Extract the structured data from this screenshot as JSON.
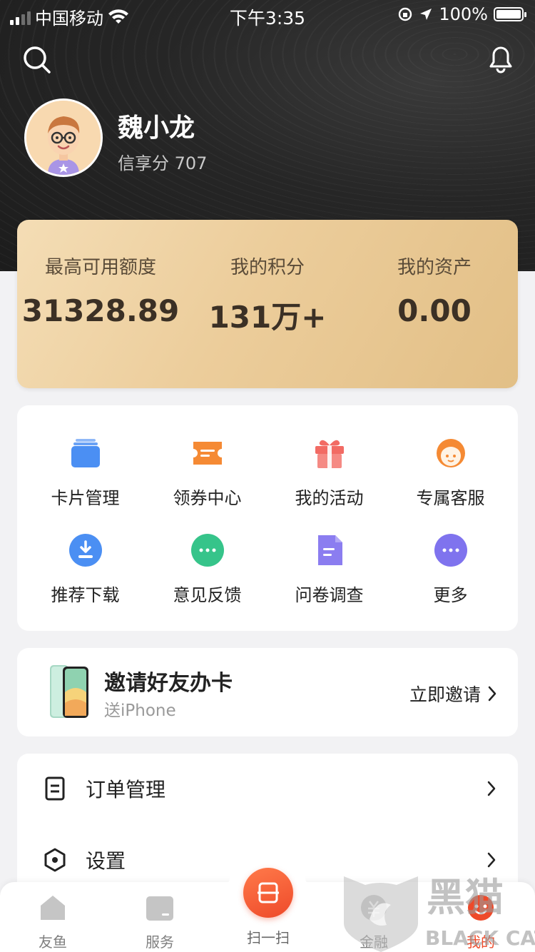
{
  "status_bar": {
    "carrier": "中国移动",
    "time": "下午3:35",
    "battery": "100%"
  },
  "profile": {
    "name": "魏小龙",
    "credit_score_text": "信享分 707"
  },
  "gold_card": [
    {
      "label": "最高可用额度",
      "value": "31328.89"
    },
    {
      "label": "我的积分",
      "value": "131万+"
    },
    {
      "label": "我的资产",
      "value": "0.00"
    }
  ],
  "services": [
    {
      "label": "卡片管理",
      "icon": "card-stack-icon",
      "color": "#4b8ff3"
    },
    {
      "label": "领券中心",
      "icon": "coupon-icon",
      "color": "#f58a34"
    },
    {
      "label": "我的活动",
      "icon": "gift-icon",
      "color": "#f26b64"
    },
    {
      "label": "专属客服",
      "icon": "customer-service-icon",
      "color": "#f58a34"
    },
    {
      "label": "推荐下载",
      "icon": "download-icon",
      "color": "#4b8ff3"
    },
    {
      "label": "意见反馈",
      "icon": "feedback-icon",
      "color": "#36c48a"
    },
    {
      "label": "问卷调查",
      "icon": "survey-icon",
      "color": "#8b7df0"
    },
    {
      "label": "更多",
      "icon": "more-icon",
      "color": "#7f73ee"
    }
  ],
  "invite": {
    "title": "邀请好友办卡",
    "subtitle": "送iPhone",
    "action": "立即邀请"
  },
  "menu": [
    {
      "label": "订单管理",
      "icon": "order-icon"
    },
    {
      "label": "设置",
      "icon": "settings-icon"
    }
  ],
  "tabbar": [
    {
      "label": "友鱼",
      "icon": "home-icon"
    },
    {
      "label": "服务",
      "icon": "service-icon"
    },
    {
      "label": "扫一扫",
      "icon": "scan-icon"
    },
    {
      "label": "金融",
      "icon": "finance-icon"
    },
    {
      "label": "我的",
      "icon": "profile-icon"
    }
  ],
  "watermark": {
    "text_cn": "黑猫",
    "text_en": "BLACK CAT"
  }
}
